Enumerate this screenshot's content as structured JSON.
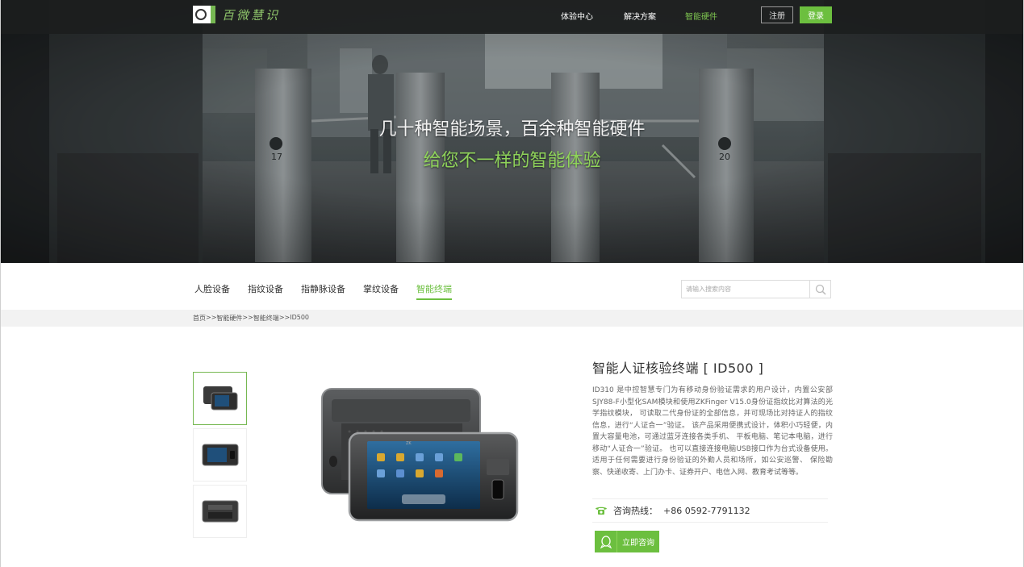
{
  "header": {
    "logo_text": "百微慧识",
    "nav": [
      {
        "label": "体验中心"
      },
      {
        "label": "解决方案"
      },
      {
        "label": "智能硬件"
      }
    ],
    "active_nav": "智能硬件",
    "register_label": "注册",
    "login_label": "登录",
    "accent_color": "#6cbf3f"
  },
  "hero": {
    "title": "几十种智能场景，百余种智能硬件",
    "subtitle": "给您不一样的智能体验",
    "station_numbers": [
      "17",
      "20"
    ]
  },
  "categories": {
    "items": [
      {
        "label": "人脸设备"
      },
      {
        "label": "指纹设备"
      },
      {
        "label": "指静脉设备"
      },
      {
        "label": "掌纹设备"
      },
      {
        "label": "智能终端"
      }
    ],
    "active": "智能终端",
    "search_placeholder": "请输入搜索内容"
  },
  "breadcrumb": {
    "items": [
      "首页",
      "智能硬件",
      "智能终端",
      "ID500"
    ],
    "separator": ">>"
  },
  "product": {
    "title": "智能人证核验终端 [ ID500 ]",
    "description": "ID310 是中控智慧专门为有移动身份验证需求的用户设计，内置公安部SJY88-F小型化SAM模块和使用ZKFinger V15.0身份证指纹比对算法的光学指纹模块， 可读取二代身份证的全部信息，并可现场比对持证人的指纹信息，进行“人证合一”验证。 该产品采用便携式设计，体积小巧轻便，内置大容量电池，可通过蓝牙连接各类手机、 平板电脑、笔记本电脑，进行移动“人证合一”验证。 也可以直接连接电脑USB接口作为台式设备使用。 适用于任何需要进行身份验证的外勤人员和场所，如公安巡警、 保险勘察、快递收寄、上门办卡、证券开户、电信入网、教育考试等等。",
    "hotline_label": "咨询热线：",
    "hotline_number": "+86 0592-7791132",
    "consult_label": "立即咨询",
    "screen_brand": "ZK"
  }
}
